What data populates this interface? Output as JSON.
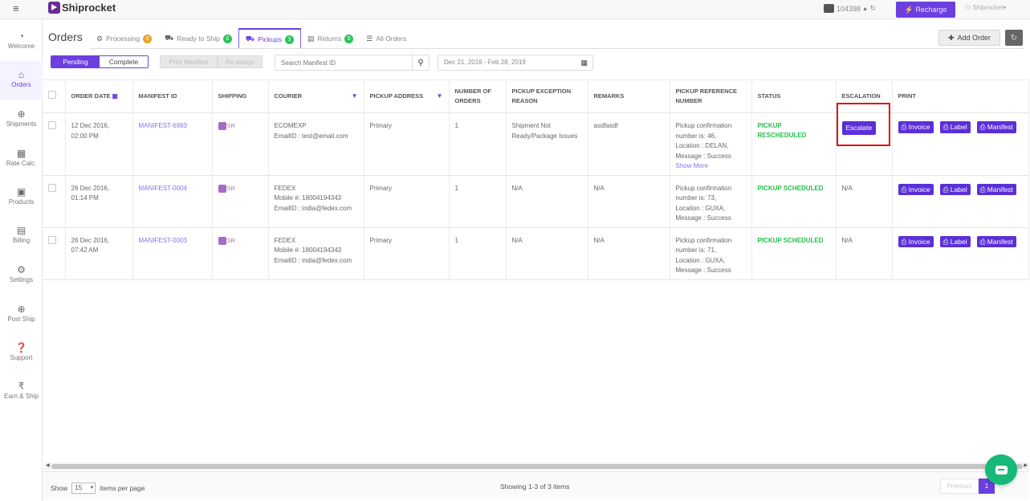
{
  "topbar": {
    "brand": "Shiprocket",
    "wallet_id": "104398",
    "recharge_label": "Recharge",
    "user_label": "Shiprocket"
  },
  "sidebar": {
    "items": [
      {
        "label": "Welcome",
        "icon": "dashboard-icon"
      },
      {
        "label": "Orders",
        "icon": "bag-icon",
        "active": true
      },
      {
        "label": "Shipments",
        "icon": "compass-icon"
      },
      {
        "label": "Rate Calc.",
        "icon": "calculator-icon"
      },
      {
        "label": "Products",
        "icon": "grid-icon"
      },
      {
        "label": "Billing",
        "icon": "document-icon"
      },
      {
        "label": "Settings",
        "icon": "gear-icon"
      },
      {
        "label": "Post Ship",
        "icon": "compass-icon"
      },
      {
        "label": "Support",
        "icon": "help-icon"
      },
      {
        "label": "Earn & Ship",
        "icon": "rupee-icon"
      }
    ]
  },
  "page": {
    "title": "Orders",
    "tabs": [
      {
        "label": "Processing",
        "count": "0"
      },
      {
        "label": "Ready to Ship",
        "count": "0"
      },
      {
        "label": "Pickups",
        "count": "3",
        "active": true
      },
      {
        "label": "Returns",
        "count": "0"
      },
      {
        "label": "All Orders"
      }
    ],
    "add_order_label": "Add Order"
  },
  "filters": {
    "pending_label": "Pending",
    "complete_label": "Complete",
    "print_manifest_label": "Print Manifest",
    "reassign_label": "Re-assign",
    "search_placeholder": "Search Manifest ID",
    "date_range": "Dec 21, 2016 - Feb 28, 2019"
  },
  "table": {
    "headers": {
      "order_date": "ORDER DATE",
      "manifest_id": "MANIFEST ID",
      "shipping": "SHIPPING",
      "courier": "COURIER",
      "pickup_address": "PICKUP ADDRESS",
      "number_of_orders": "NUMBER OF ORDERS",
      "pickup_exception_reason": "PICKUP EXCEPTION REASON",
      "remarks": "REMARKS",
      "pickup_reference_number": "PICKUP REFERENCE NUMBER",
      "status": "STATUS",
      "escalation": "ESCALATION",
      "print": "PRINT"
    },
    "rows": [
      {
        "date_1": "12 Dec 2016,",
        "date_2": "02:00 PM",
        "manifest": "MANIFEST-6983",
        "shipping": "SR",
        "courier_1": "ECOMEXP",
        "courier_2": "EmailID : test@email.com",
        "courier_3": "",
        "pickup": "Primary",
        "orders": "1",
        "exception": "Shipment Not Ready/Package Issues",
        "remarks": "asdfasdf",
        "ref_1": "Pickup confirmation",
        "ref_2": "number is: 46,",
        "ref_3": "Location : DELAN,",
        "ref_4": "Message : Success",
        "ref_more": "Show More",
        "status": "PICKUP RESCHEDULED",
        "escalation": "Escalate"
      },
      {
        "date_1": "26 Dec 2016,",
        "date_2": "01:14 PM",
        "manifest": "MANIFEST-0004",
        "shipping": "SR",
        "courier_1": "FEDEX",
        "courier_2": "Mobile #: 18004194343",
        "courier_3": "EmailID : india@fedex.com",
        "pickup": "Primary",
        "orders": "1",
        "exception": "N/A",
        "remarks": "N/A",
        "ref_1": "Pickup confirmation",
        "ref_2": "number is: 73,",
        "ref_3": "Location : GUXA,",
        "ref_4": "Message : Success",
        "ref_more": "",
        "status": "PICKUP SCHEDULED",
        "escalation": "N/A"
      },
      {
        "date_1": "26 Dec 2016,",
        "date_2": "07:42 AM",
        "manifest": "MANIFEST-0003",
        "shipping": "SR",
        "courier_1": "FEDEX",
        "courier_2": "Mobile #: 18004194343",
        "courier_3": "EmailID : india@fedex.com",
        "pickup": "Primary",
        "orders": "1",
        "exception": "N/A",
        "remarks": "N/A",
        "ref_1": "Pickup confirmation",
        "ref_2": "number is: 71,",
        "ref_3": "Location : GUXA,",
        "ref_4": "Message : Success",
        "ref_more": "",
        "status": "PICKUP SCHEDULED",
        "escalation": "N/A"
      }
    ],
    "print_buttons": {
      "invoice": "Invoice",
      "label": "Label",
      "manifest": "Manifest"
    }
  },
  "footer": {
    "show_label": "Show",
    "per_page_value": "15",
    "items_per_page_label": "items per page",
    "showing_text": "Showing 1-3 of 3 items",
    "previous_label": "Previous",
    "page_number": "1"
  },
  "colors": {
    "brand": "#6b3fe0",
    "status_green": "#23c04a",
    "highlight_red": "#e01010",
    "chat_green": "#17b978"
  }
}
